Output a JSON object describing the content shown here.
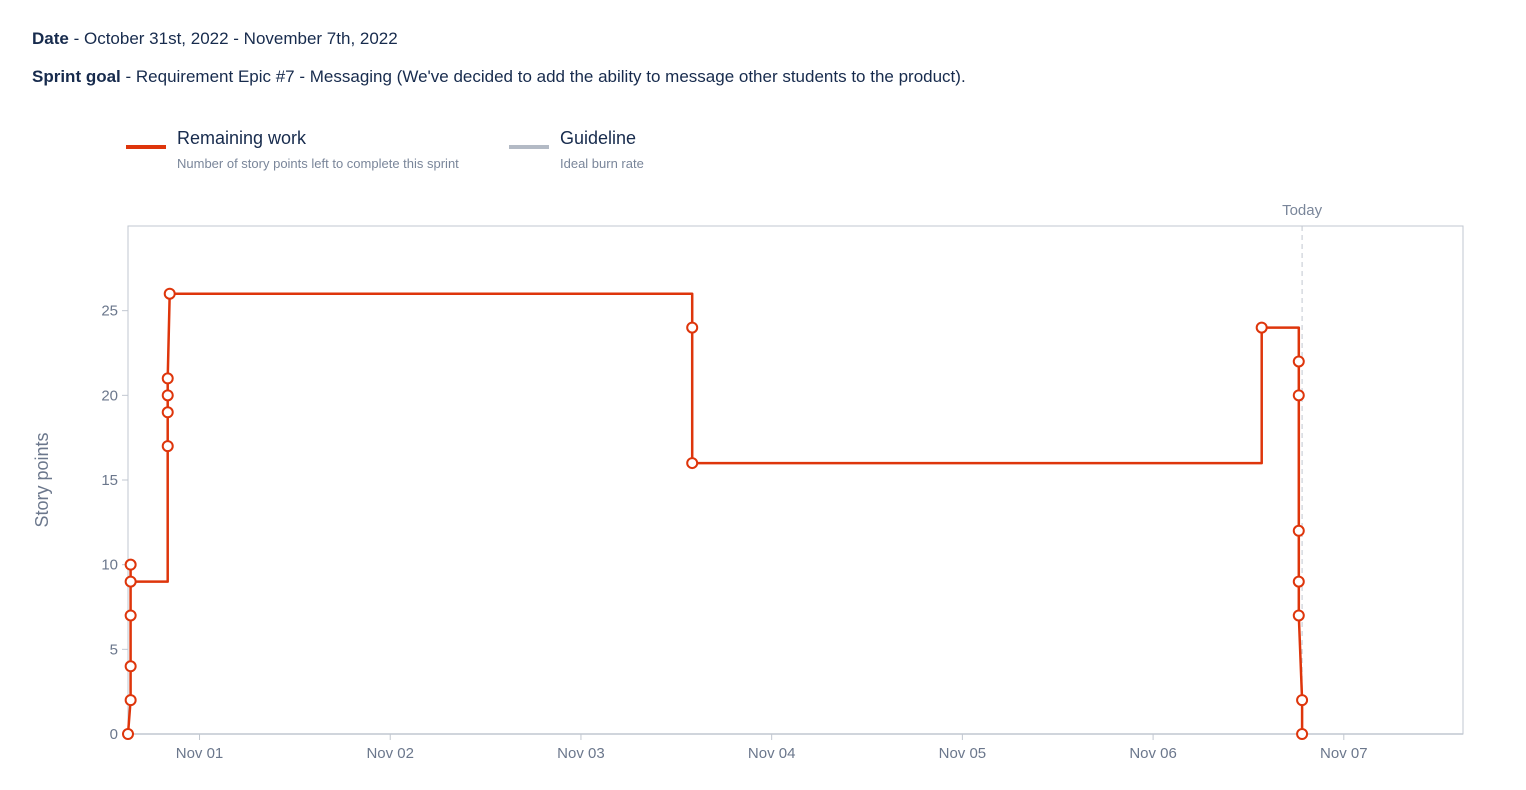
{
  "header": {
    "date_label": "Date",
    "date_value": " - October 31st, 2022 - November 7th, 2022",
    "goal_label": "Sprint goal",
    "goal_value": " - Requirement Epic #7 - Messaging (We've decided to add the ability to message other students to the product)."
  },
  "colors": {
    "remaining": "#de350b",
    "guideline": "#b3bac5",
    "axis": "#c1c7d0",
    "today": "#c1c7d0"
  },
  "chart_data": {
    "type": "line",
    "title": "",
    "xlabel": "",
    "ylabel": "Story points",
    "ylim": [
      0,
      30
    ],
    "yticks": [
      0,
      5,
      10,
      15,
      20,
      25
    ],
    "xlim": [
      "2022-10-31T15:00",
      "2022-11-07T15:00"
    ],
    "xticks": [
      {
        "date": "2022-11-01T00:00",
        "label": "Nov 01"
      },
      {
        "date": "2022-11-02T00:00",
        "label": "Nov 02"
      },
      {
        "date": "2022-11-03T00:00",
        "label": "Nov 03"
      },
      {
        "date": "2022-11-04T00:00",
        "label": "Nov 04"
      },
      {
        "date": "2022-11-05T00:00",
        "label": "Nov 05"
      },
      {
        "date": "2022-11-06T00:00",
        "label": "Nov 06"
      },
      {
        "date": "2022-11-07T00:00",
        "label": "Nov 07"
      }
    ],
    "today": {
      "label": "Today",
      "date": "2022-11-06T18:45"
    },
    "legend": [
      {
        "name": "Remaining work",
        "description": "Number of story points left to complete this sprint",
        "color": "#de350b"
      },
      {
        "name": "Guideline",
        "description": "Ideal burn rate",
        "color": "#b3bac5"
      }
    ],
    "series": [
      {
        "name": "Remaining work",
        "step": true,
        "points": [
          {
            "x": "2022-10-31T15:00",
            "y": 0,
            "marker": true
          },
          {
            "x": "2022-10-31T15:20",
            "y": 2,
            "marker": true
          },
          {
            "x": "2022-10-31T15:20",
            "y": 4,
            "marker": true
          },
          {
            "x": "2022-10-31T15:20",
            "y": 7,
            "marker": true
          },
          {
            "x": "2022-10-31T15:20",
            "y": 9,
            "marker": true
          },
          {
            "x": "2022-10-31T15:20",
            "y": 10,
            "marker": true
          },
          {
            "x": "2022-10-31T15:20",
            "y": 9,
            "marker": false
          },
          {
            "x": "2022-10-31T20:00",
            "y": 9,
            "marker": false
          },
          {
            "x": "2022-10-31T20:00",
            "y": 17,
            "marker": true
          },
          {
            "x": "2022-10-31T20:00",
            "y": 19,
            "marker": true
          },
          {
            "x": "2022-10-31T20:00",
            "y": 20,
            "marker": true
          },
          {
            "x": "2022-10-31T20:00",
            "y": 21,
            "marker": true
          },
          {
            "x": "2022-10-31T20:15",
            "y": 26,
            "marker": true
          },
          {
            "x": "2022-11-03T14:00",
            "y": 26,
            "marker": false
          },
          {
            "x": "2022-11-03T14:00",
            "y": 24,
            "marker": true
          },
          {
            "x": "2022-11-03T14:00",
            "y": 16,
            "marker": true
          },
          {
            "x": "2022-11-06T13:40",
            "y": 16,
            "marker": false
          },
          {
            "x": "2022-11-06T13:40",
            "y": 24,
            "marker": true
          },
          {
            "x": "2022-11-06T18:20",
            "y": 24,
            "marker": false
          },
          {
            "x": "2022-11-06T18:20",
            "y": 22,
            "marker": true
          },
          {
            "x": "2022-11-06T18:20",
            "y": 20,
            "marker": true
          },
          {
            "x": "2022-11-06T18:20",
            "y": 12,
            "marker": true
          },
          {
            "x": "2022-11-06T18:20",
            "y": 9,
            "marker": true
          },
          {
            "x": "2022-11-06T18:20",
            "y": 7,
            "marker": true
          },
          {
            "x": "2022-11-06T18:45",
            "y": 2,
            "marker": true
          },
          {
            "x": "2022-11-06T18:45",
            "y": 0,
            "marker": true
          }
        ]
      }
    ]
  }
}
